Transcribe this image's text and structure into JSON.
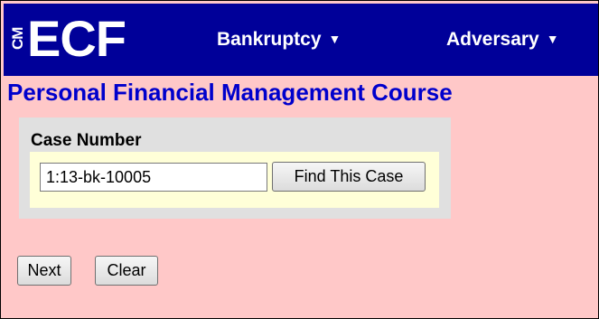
{
  "header": {
    "logo_cm": "CM",
    "logo_ecf": "ECF",
    "menus": [
      {
        "label": "Bankruptcy",
        "icon": "chevron-down-icon"
      },
      {
        "label": "Adversary",
        "icon": "chevron-down-icon"
      }
    ]
  },
  "page": {
    "title": "Personal Financial Management Course"
  },
  "case_search": {
    "label": "Case Number",
    "value": "1:13-bk-10005",
    "find_button": "Find This Case"
  },
  "actions": {
    "next_label": "Next",
    "clear_label": "Clear"
  },
  "colors": {
    "header_bg": "#000099",
    "page_bg": "#ffc8c8",
    "title": "#0000cc",
    "panel_bg": "#e0e0e0",
    "panel_inner_bg": "#ffffd8"
  }
}
